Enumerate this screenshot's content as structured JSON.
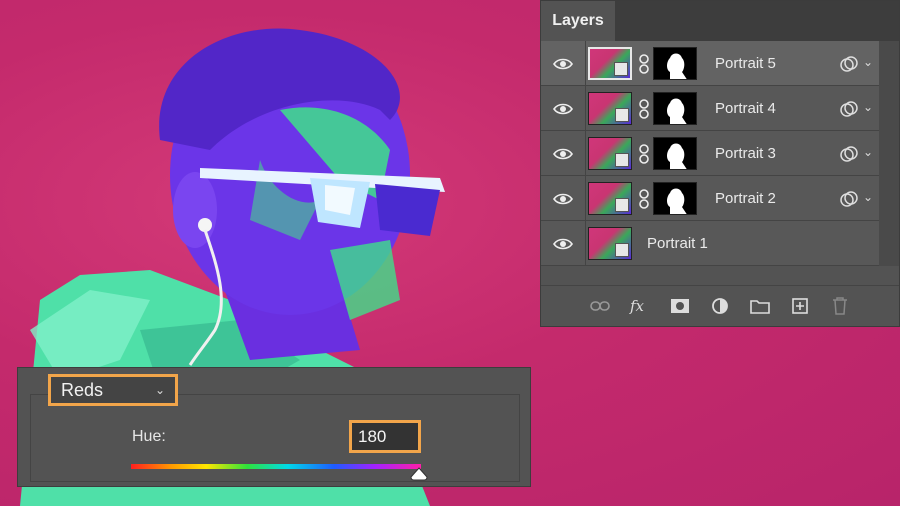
{
  "colors": {
    "accent_highlight": "#f2a54a",
    "panel_bg": "#535353",
    "background_magenta": "#c42a6c"
  },
  "layers_panel": {
    "title": "Layers",
    "layers": [
      {
        "name": "Portrait 5",
        "selected": true,
        "has_mask": true
      },
      {
        "name": "Portrait 4",
        "selected": false,
        "has_mask": true
      },
      {
        "name": "Portrait 3",
        "selected": false,
        "has_mask": true
      },
      {
        "name": "Portrait 2",
        "selected": false,
        "has_mask": true
      },
      {
        "name": "Portrait 1",
        "selected": false,
        "has_mask": false
      }
    ],
    "footer_icons": [
      "link-layers-icon",
      "fx-icon",
      "add-mask-icon",
      "adjustment-layer-icon",
      "new-group-icon",
      "new-layer-icon",
      "delete-icon"
    ]
  },
  "hue_panel": {
    "channel": "Reds",
    "hue_label": "Hue:",
    "hue_value": "180",
    "hue_slider_fraction": 1.0
  }
}
